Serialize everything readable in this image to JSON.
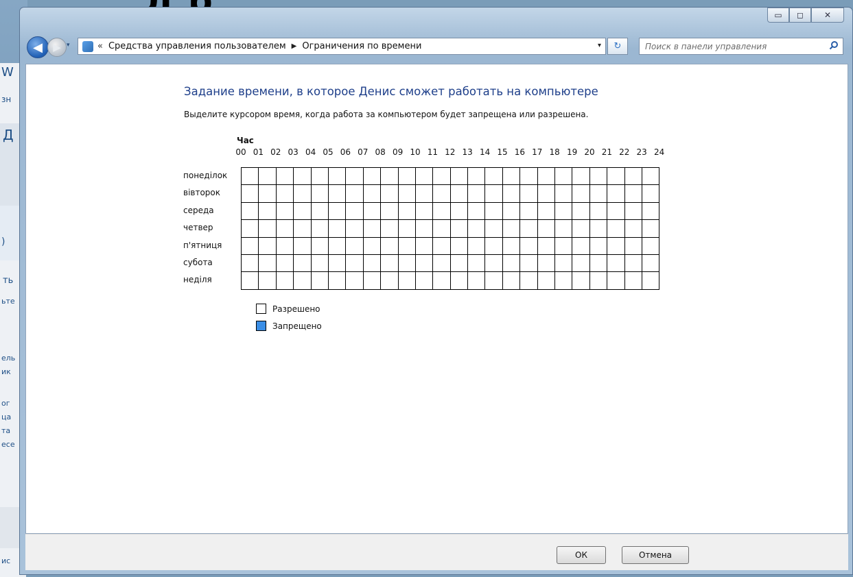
{
  "overlay": {
    "title_fragment": "Д          р"
  },
  "background_window": {
    "fragments": [
      "W",
      "зн",
      "Д",
      ")",
      "ть",
      "ьте",
      "ель",
      "ик",
      "ог",
      "ца",
      "та",
      "есе",
      "ис"
    ]
  },
  "window": {
    "caption_buttons": {
      "minimize": "▭",
      "maximize": "◻",
      "close": "✕"
    }
  },
  "nav": {
    "back_glyph": "◀",
    "forward_glyph": "▶",
    "history_glyph": "▾",
    "breadcrumb": {
      "overflow": "«",
      "items": [
        "Средства управления пользователем",
        "Ограничения по времени"
      ],
      "separator": "▶",
      "dropdown": "▾"
    },
    "refresh_glyph": "↻",
    "search_placeholder": "Поиск в панели управления"
  },
  "main": {
    "heading": "Задание времени, в которое Денис сможет работать на компьютере",
    "instruction": "Выделите курсором время, когда работа за компьютером будет запрещена или разрешена.",
    "hour_label": "Час",
    "hours": [
      "00",
      "01",
      "02",
      "03",
      "04",
      "05",
      "06",
      "07",
      "08",
      "09",
      "10",
      "11",
      "12",
      "13",
      "14",
      "15",
      "16",
      "17",
      "18",
      "19",
      "20",
      "21",
      "22",
      "23",
      "24"
    ],
    "days": [
      "понеділок",
      "вівторок",
      "середа",
      "четвер",
      "п'ятниця",
      "субота",
      "неділя"
    ],
    "legend": [
      {
        "label": "Разрешено",
        "color": "#ffffff"
      },
      {
        "label": "Запрещено",
        "color": "#3a8ee6"
      }
    ]
  },
  "footer": {
    "ok_label": "ОК",
    "cancel_label": "Отмена"
  }
}
